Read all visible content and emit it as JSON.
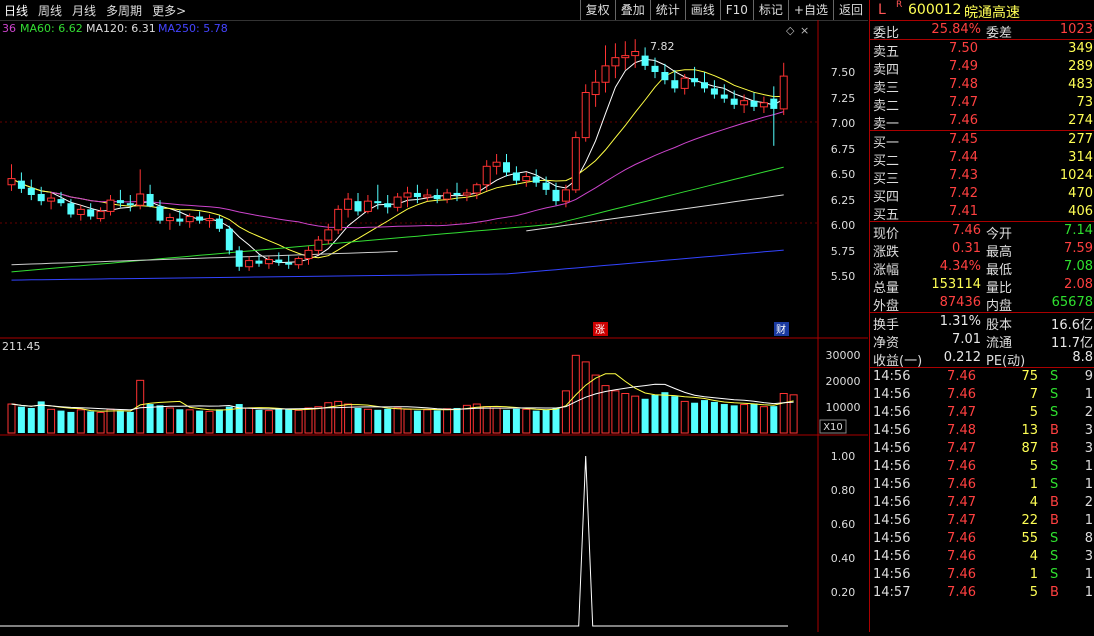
{
  "toolbar": {
    "period_tabs": [
      "日线",
      "周线",
      "月线",
      "多周期",
      "更多>"
    ],
    "buttons": [
      "复权",
      "叠加",
      "统计",
      "画线",
      "F10",
      "标记",
      "+自选",
      "返回"
    ]
  },
  "main_chart": {
    "ma_legend": [
      {
        "label": "36",
        "color": "#cc44cc"
      },
      {
        "label": "MA60: 6.62",
        "color": "#33dd33"
      },
      {
        "label": "MA120: 6.31",
        "color": "#dddddd"
      },
      {
        "label": "MA250: 5.78",
        "color": "#4444ff"
      }
    ],
    "y_ticks": [
      "7.50",
      "7.25",
      "7.00",
      "6.75",
      "6.50",
      "6.25",
      "6.00",
      "5.75",
      "5.50"
    ],
    "high_label": "7.82",
    "markers": [
      "涨",
      "财"
    ]
  },
  "volume_panel": {
    "left_value": "211.45",
    "y_ticks": [
      "30000",
      "20000",
      "10000"
    ],
    "scale_label": "X10"
  },
  "indicator_panel": {
    "y_ticks": [
      "1.00",
      "0.80",
      "0.60",
      "0.40",
      "0.20"
    ]
  },
  "chart_data": {
    "type": "candlestick",
    "title": "",
    "ylim": [
      5.4,
      7.9
    ],
    "candles": [
      {
        "o": 6.4,
        "h": 6.6,
        "l": 6.34,
        "c": 6.46
      },
      {
        "o": 6.44,
        "h": 6.52,
        "l": 6.32,
        "c": 6.36
      },
      {
        "o": 6.37,
        "h": 6.45,
        "l": 6.25,
        "c": 6.3
      },
      {
        "o": 6.31,
        "h": 6.38,
        "l": 6.2,
        "c": 6.24
      },
      {
        "o": 6.24,
        "h": 6.32,
        "l": 6.16,
        "c": 6.27
      },
      {
        "o": 6.26,
        "h": 6.33,
        "l": 6.19,
        "c": 6.22
      },
      {
        "o": 6.22,
        "h": 6.26,
        "l": 6.08,
        "c": 6.11
      },
      {
        "o": 6.11,
        "h": 6.2,
        "l": 6.05,
        "c": 6.16
      },
      {
        "o": 6.16,
        "h": 6.22,
        "l": 6.06,
        "c": 6.09
      },
      {
        "o": 6.07,
        "h": 6.18,
        "l": 6.04,
        "c": 6.14
      },
      {
        "o": 6.14,
        "h": 6.3,
        "l": 6.1,
        "c": 6.25
      },
      {
        "o": 6.25,
        "h": 6.35,
        "l": 6.18,
        "c": 6.22
      },
      {
        "o": 6.22,
        "h": 6.3,
        "l": 6.14,
        "c": 6.2
      },
      {
        "o": 6.2,
        "h": 6.55,
        "l": 6.16,
        "c": 6.31
      },
      {
        "o": 6.31,
        "h": 6.4,
        "l": 6.18,
        "c": 6.19
      },
      {
        "o": 6.19,
        "h": 6.25,
        "l": 6.02,
        "c": 6.05
      },
      {
        "o": 6.05,
        "h": 6.12,
        "l": 5.96,
        "c": 6.08
      },
      {
        "o": 6.07,
        "h": 6.15,
        "l": 6.0,
        "c": 6.04
      },
      {
        "o": 6.04,
        "h": 6.12,
        "l": 5.98,
        "c": 6.09
      },
      {
        "o": 6.09,
        "h": 6.14,
        "l": 6.02,
        "c": 6.05
      },
      {
        "o": 6.05,
        "h": 6.11,
        "l": 5.98,
        "c": 6.07
      },
      {
        "o": 6.07,
        "h": 6.1,
        "l": 5.94,
        "c": 5.97
      },
      {
        "o": 5.97,
        "h": 6.0,
        "l": 5.72,
        "c": 5.76
      },
      {
        "o": 5.76,
        "h": 5.8,
        "l": 5.56,
        "c": 5.6
      },
      {
        "o": 5.6,
        "h": 5.7,
        "l": 5.56,
        "c": 5.66
      },
      {
        "o": 5.66,
        "h": 5.72,
        "l": 5.6,
        "c": 5.63
      },
      {
        "o": 5.63,
        "h": 5.7,
        "l": 5.58,
        "c": 5.67
      },
      {
        "o": 5.67,
        "h": 5.74,
        "l": 5.61,
        "c": 5.64
      },
      {
        "o": 5.64,
        "h": 5.71,
        "l": 5.58,
        "c": 5.62
      },
      {
        "o": 5.62,
        "h": 5.7,
        "l": 5.58,
        "c": 5.68
      },
      {
        "o": 5.68,
        "h": 5.8,
        "l": 5.62,
        "c": 5.76
      },
      {
        "o": 5.76,
        "h": 5.9,
        "l": 5.72,
        "c": 5.86
      },
      {
        "o": 5.86,
        "h": 6.02,
        "l": 5.82,
        "c": 5.96
      },
      {
        "o": 5.96,
        "h": 6.2,
        "l": 5.92,
        "c": 6.16
      },
      {
        "o": 6.16,
        "h": 6.32,
        "l": 6.08,
        "c": 6.26
      },
      {
        "o": 6.24,
        "h": 6.32,
        "l": 6.1,
        "c": 6.14
      },
      {
        "o": 6.14,
        "h": 6.3,
        "l": 6.12,
        "c": 6.24
      },
      {
        "o": 6.24,
        "h": 6.4,
        "l": 6.16,
        "c": 6.22
      },
      {
        "o": 6.22,
        "h": 6.3,
        "l": 6.12,
        "c": 6.18
      },
      {
        "o": 6.18,
        "h": 6.32,
        "l": 6.14,
        "c": 6.28
      },
      {
        "o": 6.28,
        "h": 6.38,
        "l": 6.18,
        "c": 6.32
      },
      {
        "o": 6.32,
        "h": 6.4,
        "l": 6.22,
        "c": 6.28
      },
      {
        "o": 6.28,
        "h": 6.36,
        "l": 6.24,
        "c": 6.3
      },
      {
        "o": 6.3,
        "h": 6.36,
        "l": 6.22,
        "c": 6.26
      },
      {
        "o": 6.26,
        "h": 6.36,
        "l": 6.22,
        "c": 6.32
      },
      {
        "o": 6.32,
        "h": 6.42,
        "l": 6.24,
        "c": 6.3
      },
      {
        "o": 6.3,
        "h": 6.36,
        "l": 6.24,
        "c": 6.32
      },
      {
        "o": 6.32,
        "h": 6.42,
        "l": 6.26,
        "c": 6.4
      },
      {
        "o": 6.4,
        "h": 6.64,
        "l": 6.34,
        "c": 6.58
      },
      {
        "o": 6.58,
        "h": 6.7,
        "l": 6.5,
        "c": 6.62
      },
      {
        "o": 6.62,
        "h": 6.7,
        "l": 6.48,
        "c": 6.52
      },
      {
        "o": 6.52,
        "h": 6.58,
        "l": 6.4,
        "c": 6.44
      },
      {
        "o": 6.44,
        "h": 6.52,
        "l": 6.38,
        "c": 6.48
      },
      {
        "o": 6.48,
        "h": 6.55,
        "l": 6.38,
        "c": 6.42
      },
      {
        "o": 6.42,
        "h": 6.48,
        "l": 6.3,
        "c": 6.35
      },
      {
        "o": 6.35,
        "h": 6.42,
        "l": 6.2,
        "c": 6.24
      },
      {
        "o": 6.24,
        "h": 6.4,
        "l": 6.18,
        "c": 6.35
      },
      {
        "o": 6.35,
        "h": 6.92,
        "l": 6.32,
        "c": 6.86
      },
      {
        "o": 6.86,
        "h": 7.38,
        "l": 6.82,
        "c": 7.3
      },
      {
        "o": 7.28,
        "h": 7.52,
        "l": 7.16,
        "c": 7.4
      },
      {
        "o": 7.4,
        "h": 7.76,
        "l": 7.3,
        "c": 7.56
      },
      {
        "o": 7.56,
        "h": 7.78,
        "l": 7.44,
        "c": 7.64
      },
      {
        "o": 7.64,
        "h": 7.8,
        "l": 7.52,
        "c": 7.66
      },
      {
        "o": 7.66,
        "h": 7.82,
        "l": 7.54,
        "c": 7.7
      },
      {
        "o": 7.66,
        "h": 7.74,
        "l": 7.52,
        "c": 7.56
      },
      {
        "o": 7.56,
        "h": 7.64,
        "l": 7.44,
        "c": 7.5
      },
      {
        "o": 7.5,
        "h": 7.58,
        "l": 7.38,
        "c": 7.42
      },
      {
        "o": 7.42,
        "h": 7.52,
        "l": 7.3,
        "c": 7.34
      },
      {
        "o": 7.34,
        "h": 7.48,
        "l": 7.28,
        "c": 7.44
      },
      {
        "o": 7.44,
        "h": 7.55,
        "l": 7.36,
        "c": 7.4
      },
      {
        "o": 7.4,
        "h": 7.5,
        "l": 7.3,
        "c": 7.34
      },
      {
        "o": 7.34,
        "h": 7.42,
        "l": 7.24,
        "c": 7.28
      },
      {
        "o": 7.28,
        "h": 7.38,
        "l": 7.2,
        "c": 7.24
      },
      {
        "o": 7.24,
        "h": 7.32,
        "l": 7.14,
        "c": 7.18
      },
      {
        "o": 7.18,
        "h": 7.28,
        "l": 7.1,
        "c": 7.22
      },
      {
        "o": 7.22,
        "h": 7.3,
        "l": 7.12,
        "c": 7.16
      },
      {
        "o": 7.16,
        "h": 7.26,
        "l": 7.1,
        "c": 7.2
      },
      {
        "o": 7.24,
        "h": 7.36,
        "l": 6.78,
        "c": 7.14
      },
      {
        "o": 7.14,
        "h": 7.59,
        "l": 7.08,
        "c": 7.46
      }
    ],
    "volume": [
      110,
      100,
      95,
      120,
      90,
      85,
      80,
      88,
      82,
      78,
      90,
      86,
      80,
      200,
      110,
      105,
      95,
      90,
      88,
      85,
      82,
      90,
      100,
      110,
      95,
      88,
      85,
      90,
      92,
      86,
      95,
      100,
      115,
      120,
      110,
      95,
      90,
      88,
      92,
      95,
      90,
      85,
      88,
      86,
      92,
      95,
      105,
      110,
      100,
      95,
      88,
      92,
      90,
      85,
      88,
      95,
      160,
      295,
      270,
      220,
      180,
      160,
      150,
      140,
      130,
      145,
      155,
      140,
      120,
      115,
      125,
      118,
      110,
      105,
      108,
      112,
      100,
      102,
      150,
      145
    ],
    "volume_scale": "X10",
    "indicator_peak": 1.0
  },
  "quote": {
    "market": "L",
    "badge": "R",
    "code": "600012",
    "name": "皖通高速",
    "webi_label": "委比",
    "webi_value": "25.84%",
    "weicha_label": "委差",
    "weicha_value": "1023",
    "asks": [
      {
        "label": "卖五",
        "price": "7.50",
        "vol": "349"
      },
      {
        "label": "卖四",
        "price": "7.49",
        "vol": "289"
      },
      {
        "label": "卖三",
        "price": "7.48",
        "vol": "483"
      },
      {
        "label": "卖二",
        "price": "7.47",
        "vol": "73"
      },
      {
        "label": "卖一",
        "price": "7.46",
        "vol": "274"
      }
    ],
    "bids": [
      {
        "label": "买一",
        "price": "7.45",
        "vol": "277"
      },
      {
        "label": "买二",
        "price": "7.44",
        "vol": "314"
      },
      {
        "label": "买三",
        "price": "7.43",
        "vol": "1024"
      },
      {
        "label": "买四",
        "price": "7.42",
        "vol": "470"
      },
      {
        "label": "买五",
        "price": "7.41",
        "vol": "406"
      }
    ],
    "stats": [
      {
        "l1": "现价",
        "v1": "7.46",
        "c1": "red",
        "l2": "今开",
        "v2": "7.14",
        "c2": "green"
      },
      {
        "l1": "涨跌",
        "v1": "0.31",
        "c1": "red",
        "l2": "最高",
        "v2": "7.59",
        "c2": "red"
      },
      {
        "l1": "涨幅",
        "v1": "4.34%",
        "c1": "red",
        "l2": "最低",
        "v2": "7.08",
        "c2": "green"
      },
      {
        "l1": "总量",
        "v1": "153114",
        "c1": "yel",
        "l2": "量比",
        "v2": "2.08",
        "c2": "red"
      },
      {
        "l1": "外盘",
        "v1": "87436",
        "c1": "red",
        "l2": "内盘",
        "v2": "65678",
        "c2": "green"
      }
    ],
    "finance": [
      {
        "l1": "换手",
        "v1": "1.31%",
        "l2": "股本",
        "v2": "16.6亿"
      },
      {
        "l1": "净资",
        "v1": "7.01",
        "l2": "流通",
        "v2": "11.7亿"
      },
      {
        "l1": "收益(一)",
        "v1": "0.212",
        "l2": "PE(动)",
        "v2": "8.8"
      }
    ],
    "trades": [
      {
        "time": "14:56",
        "price": "7.46",
        "vol": "75",
        "bs": "S",
        "n": "9"
      },
      {
        "time": "14:56",
        "price": "7.46",
        "vol": "7",
        "bs": "S",
        "n": "1"
      },
      {
        "time": "14:56",
        "price": "7.47",
        "vol": "5",
        "bs": "S",
        "n": "2"
      },
      {
        "time": "14:56",
        "price": "7.48",
        "vol": "13",
        "bs": "B",
        "n": "3"
      },
      {
        "time": "14:56",
        "price": "7.47",
        "vol": "87",
        "bs": "B",
        "n": "3"
      },
      {
        "time": "14:56",
        "price": "7.46",
        "vol": "5",
        "bs": "S",
        "n": "1"
      },
      {
        "time": "14:56",
        "price": "7.46",
        "vol": "1",
        "bs": "S",
        "n": "1"
      },
      {
        "time": "14:56",
        "price": "7.47",
        "vol": "4",
        "bs": "B",
        "n": "2"
      },
      {
        "time": "14:56",
        "price": "7.47",
        "vol": "22",
        "bs": "B",
        "n": "1"
      },
      {
        "time": "14:56",
        "price": "7.46",
        "vol": "55",
        "bs": "S",
        "n": "8"
      },
      {
        "time": "14:56",
        "price": "7.46",
        "vol": "4",
        "bs": "S",
        "n": "3"
      },
      {
        "time": "14:56",
        "price": "7.46",
        "vol": "1",
        "bs": "S",
        "n": "1"
      },
      {
        "time": "14:57",
        "price": "7.46",
        "vol": "5",
        "bs": "B",
        "n": "1"
      }
    ]
  }
}
